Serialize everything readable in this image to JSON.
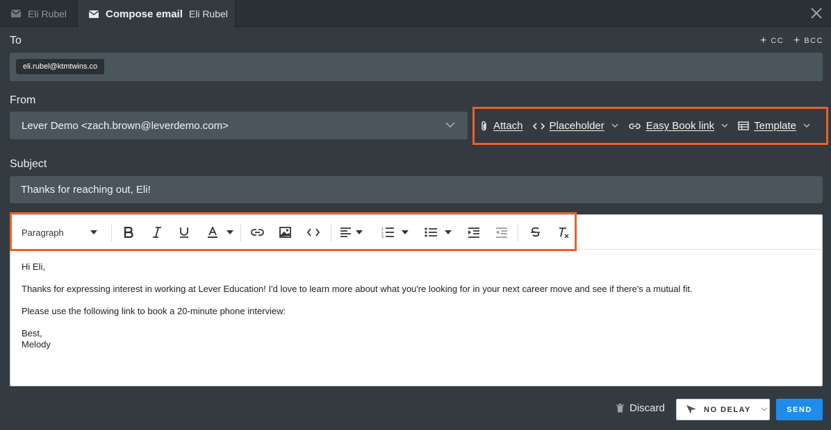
{
  "tabs": [
    {
      "label": "Eli Rubel",
      "icon": "mail-icon"
    },
    {
      "title": "Compose email",
      "name": "Eli Rubel",
      "icon": "mail-icon"
    }
  ],
  "to": {
    "label": "To",
    "recipient": "eli.rubel@ktmtwins.co",
    "cc_label": "CC",
    "bcc_label": "BCC"
  },
  "from": {
    "label": "From",
    "value": "Lever Demo <zach.brown@leverdemo.com>"
  },
  "actions": {
    "attach": "Attach",
    "placeholder": "Placeholder",
    "easy_book": "Easy Book link",
    "template": "Template"
  },
  "subject": {
    "label": "Subject",
    "value": "Thanks for reaching out, Eli!"
  },
  "toolbar": {
    "format": "Paragraph"
  },
  "body": {
    "greeting": "Hi Eli,",
    "line1": "Thanks for expressing interest in working at Lever Education! I'd love to learn more about what you're looking for in your next career move and see if there's a mutual fit.",
    "line2": "Please use the following link to book a 20-minute phone interview:",
    "closing": "Best,",
    "signature": "Melody"
  },
  "footer": {
    "discard": "Discard",
    "delay": "NO DELAY",
    "send": "SEND"
  },
  "colors": {
    "highlight": "#e8612c",
    "send": "#1f8ceb"
  }
}
